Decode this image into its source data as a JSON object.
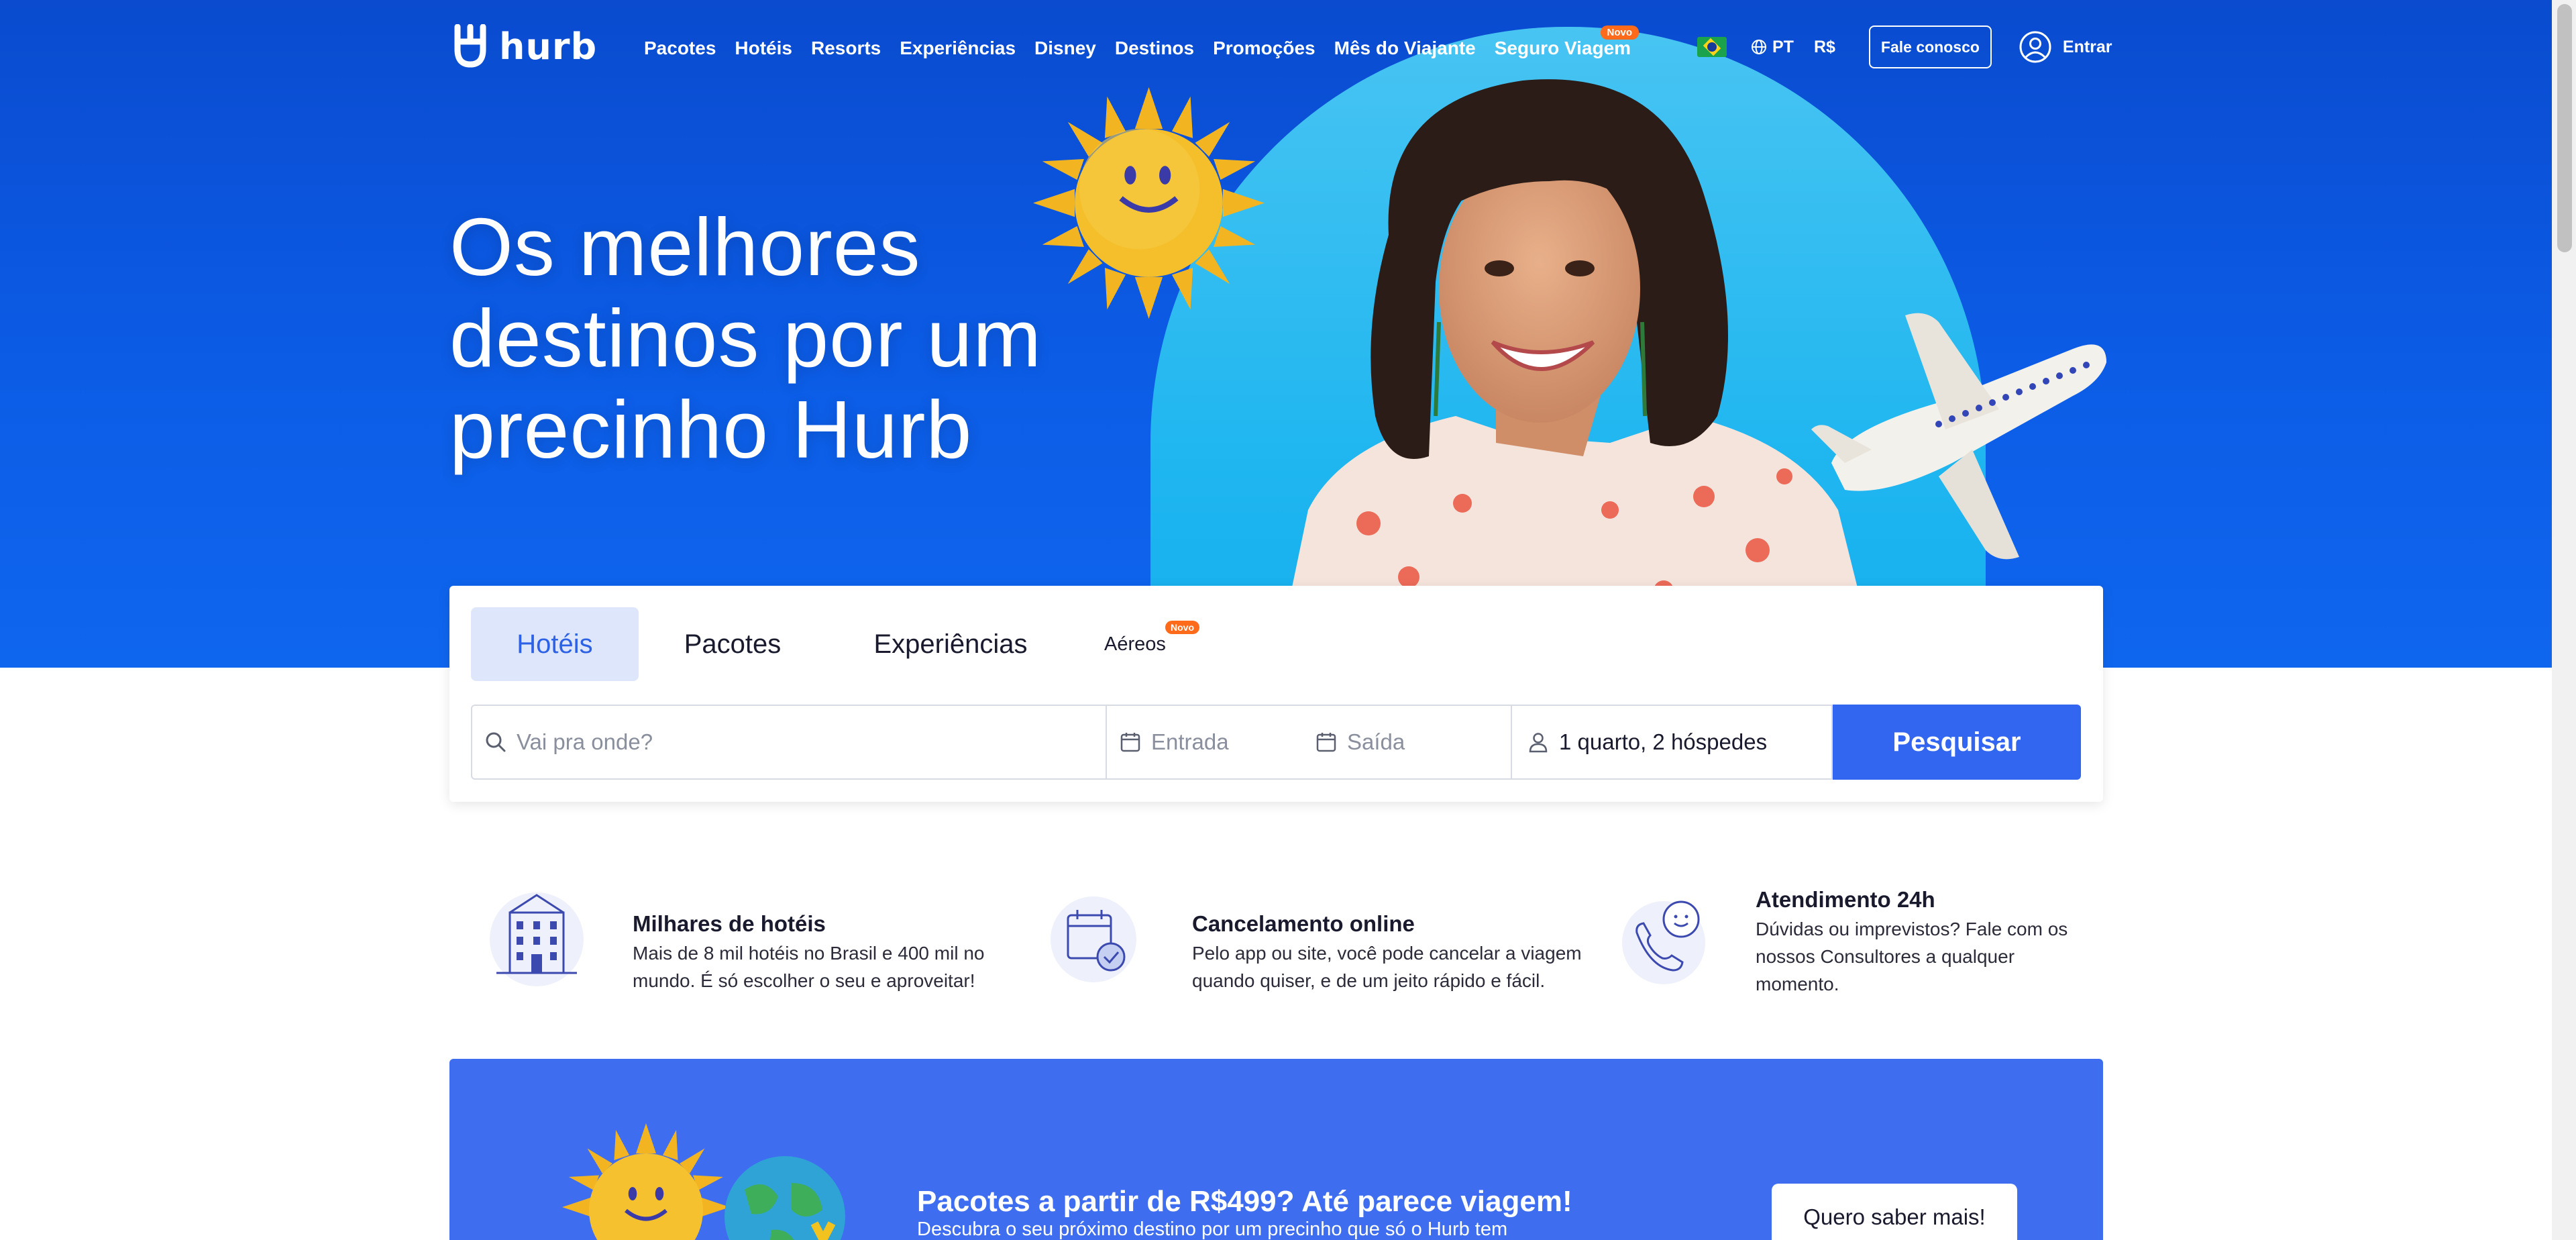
{
  "brand": {
    "name": "hurb"
  },
  "nav": {
    "items": [
      "Pacotes",
      "Hotéis",
      "Resorts",
      "Experiências",
      "Disney",
      "Destinos",
      "Promoções",
      "Mês do Viajante",
      "Seguro Viagem"
    ],
    "seguro_badge": "Novo",
    "language": "PT",
    "currency": "R$",
    "contact": "Fale conosco",
    "login": "Entrar"
  },
  "hero": {
    "headline_lines": [
      "Os melhores",
      "destinos por um",
      "precinho Hurb"
    ]
  },
  "search": {
    "tabs": [
      {
        "label": "Hotéis",
        "active": true
      },
      {
        "label": "Pacotes",
        "active": false
      },
      {
        "label": "Experiências",
        "active": false
      },
      {
        "label": "Aéreos",
        "active": false,
        "badge": "Novo"
      }
    ],
    "destination_placeholder": "Vai pra onde?",
    "checkin_placeholder": "Entrada",
    "checkout_placeholder": "Saída",
    "guests_value": "1 quarto, 2 hóspedes",
    "button": "Pesquisar"
  },
  "features": [
    {
      "title": "Milhares de hotéis",
      "lines": [
        "Mais de 8 mil hotéis no Brasil e 400 mil no",
        "mundo. É só escolher o seu e aproveitar!"
      ]
    },
    {
      "title": "Cancelamento online",
      "lines": [
        "Pelo app ou site, você pode cancelar a viagem",
        "quando quiser, e de um jeito rápido e fácil."
      ]
    },
    {
      "title": "Atendimento 24h",
      "lines": [
        "Dúvidas ou imprevistos? Fale com os",
        "nossos Consultores a qualquer",
        "momento."
      ]
    }
  ],
  "promo": {
    "title": "Pacotes a partir de R$499? Até parece viagem!",
    "subtitle": "Descubra o seu próximo destino por um precinho que só o Hurb tem",
    "button": "Quero saber mais!"
  },
  "colors": {
    "hero_blue": "#0c5ce6",
    "accent_blue": "#3366f0",
    "promo_blue": "#3e6df0",
    "badge_orange": "#ff6b1a",
    "tab_active_bg": "#dde6fb"
  },
  "icons": [
    "hurb-logo-icon",
    "brazil-flag-icon",
    "globe-icon",
    "user-icon",
    "search-icon",
    "calendar-icon",
    "person-icon",
    "hotel-building-icon",
    "calendar-check-icon",
    "chat-phone-icon"
  ]
}
